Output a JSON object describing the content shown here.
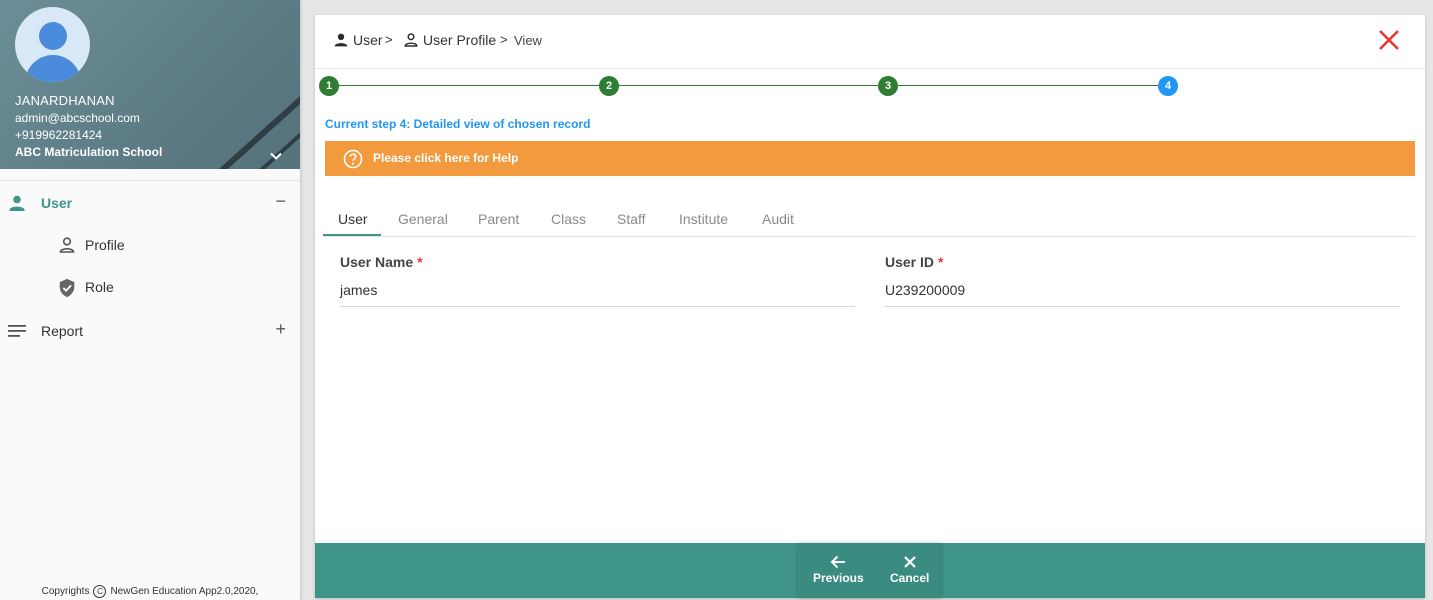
{
  "sidebar": {
    "profile": {
      "name": "JANARDHANAN",
      "email": "admin@abcschool.com",
      "phone": "+919962281424",
      "school": "ABC Matriculation School"
    },
    "menu": [
      {
        "label": "User",
        "icon": "person-icon",
        "toggle": "−",
        "active": true
      },
      {
        "label": "Profile",
        "icon": "person-outline-icon"
      },
      {
        "label": "Role",
        "icon": "shield-check-icon"
      },
      {
        "label": "Report",
        "icon": "list-lines-icon",
        "toggle": "+"
      }
    ],
    "footer": {
      "prefix": "Copyrights",
      "text": "NewGen Education App2.0,2020,"
    }
  },
  "breadcrumb": [
    {
      "label": "User",
      "icon": "person-icon"
    },
    {
      "label": "User Profile",
      "icon": "person-outline-icon"
    },
    {
      "label": "View"
    }
  ],
  "breadcrumb_separator": ">",
  "stepper": {
    "steps": [
      "1",
      "2",
      "3",
      "4"
    ],
    "current_step": 4,
    "caption": "Current step 4: Detailed view of chosen record",
    "colors": {
      "done": "#2e7d32",
      "current": "#2196f3"
    }
  },
  "help": {
    "label": "Please click here for Help",
    "icon": "help-circle-icon",
    "color": "#f39a3e"
  },
  "tabs": [
    "User",
    "General",
    "Parent",
    "Class",
    "Staff",
    "Institute",
    "Audit"
  ],
  "active_tab": "User",
  "fields": [
    {
      "label": "User Name",
      "required_mark": "*",
      "value": "james"
    },
    {
      "label": "User ID",
      "required_mark": "*",
      "value": "U239200009"
    }
  ],
  "actions": [
    {
      "label": "Previous",
      "icon": "arrow-left-icon"
    },
    {
      "label": "Cancel",
      "icon": "close-icon"
    }
  ],
  "close_icon": "close-icon",
  "colors": {
    "accent": "#3f9686",
    "action_bar": "#40958a",
    "close": "#e53935"
  }
}
